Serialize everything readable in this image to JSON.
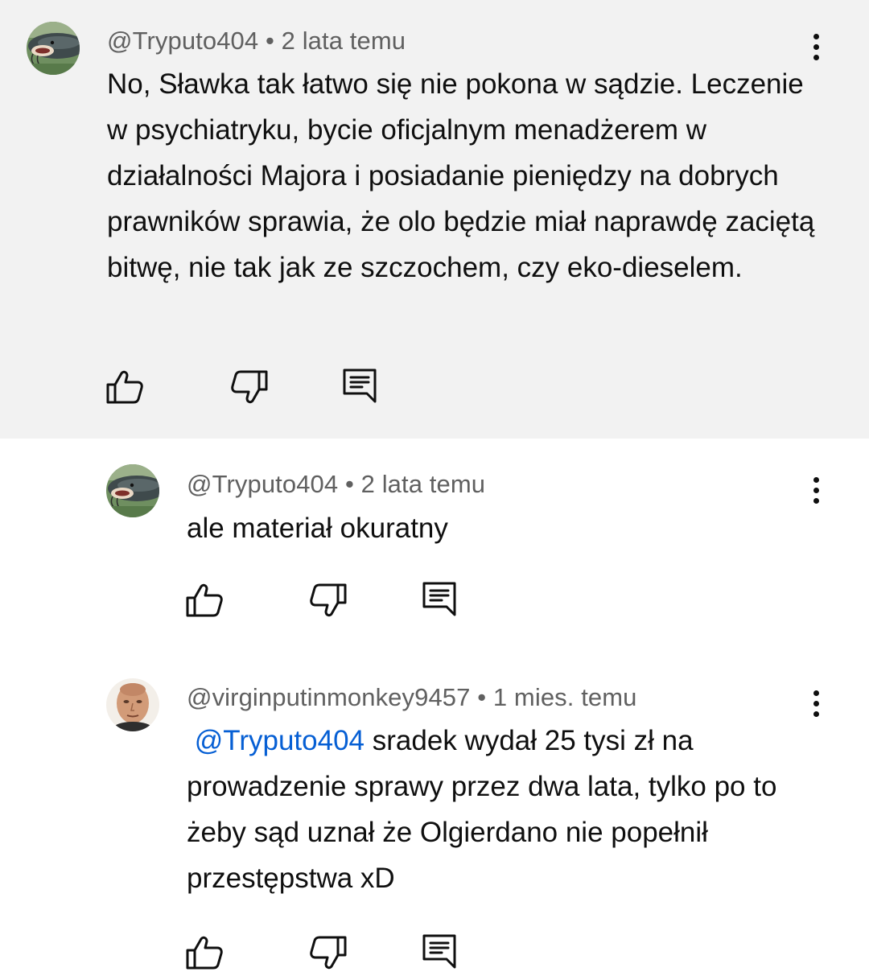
{
  "comments": [
    {
      "author": "@Tryputo404",
      "separator": "•",
      "time": "2 lata temu",
      "avatar": "catfish-avatar",
      "text": "No, Sławka tak łatwo się nie pokona w sądzie. Leczenie w psychiatryku, bycie oficjalnym menadżerem w działalności Majora i posiadanie pieniędzy na dobrych prawników sprawia, że olo będzie miał naprawdę zaciętą bitwę, nie tak jak ze szczochem, czy eko-dieselem.",
      "highlighted": true
    },
    {
      "author": "@Tryputo404",
      "separator": "•",
      "time": "2 lata temu",
      "avatar": "catfish-avatar",
      "text": "ale materiał okuratny",
      "highlighted": false
    },
    {
      "author": "@virginputinmonkey9457",
      "separator": "•",
      "time": "1 mies. temu",
      "avatar": "face-avatar",
      "mention": "@Tryputo404",
      "text": "sradek wydał 25 tysi zł na prowadzenie sprawy przez dwa lata, tylko po to żeby sąd uznał że Olgierdano nie popełnił przestępstwa xD",
      "highlighted": false
    }
  ],
  "icons": {
    "like": "thumbs-up-icon",
    "dislike": "thumbs-down-icon",
    "reply": "reply-comment-icon",
    "more": "more-vert-icon"
  },
  "colors": {
    "highlight_bg": "#f2f2f2",
    "meta_text": "#606060",
    "mention": "#065fd4",
    "text": "#0f0f0f"
  }
}
